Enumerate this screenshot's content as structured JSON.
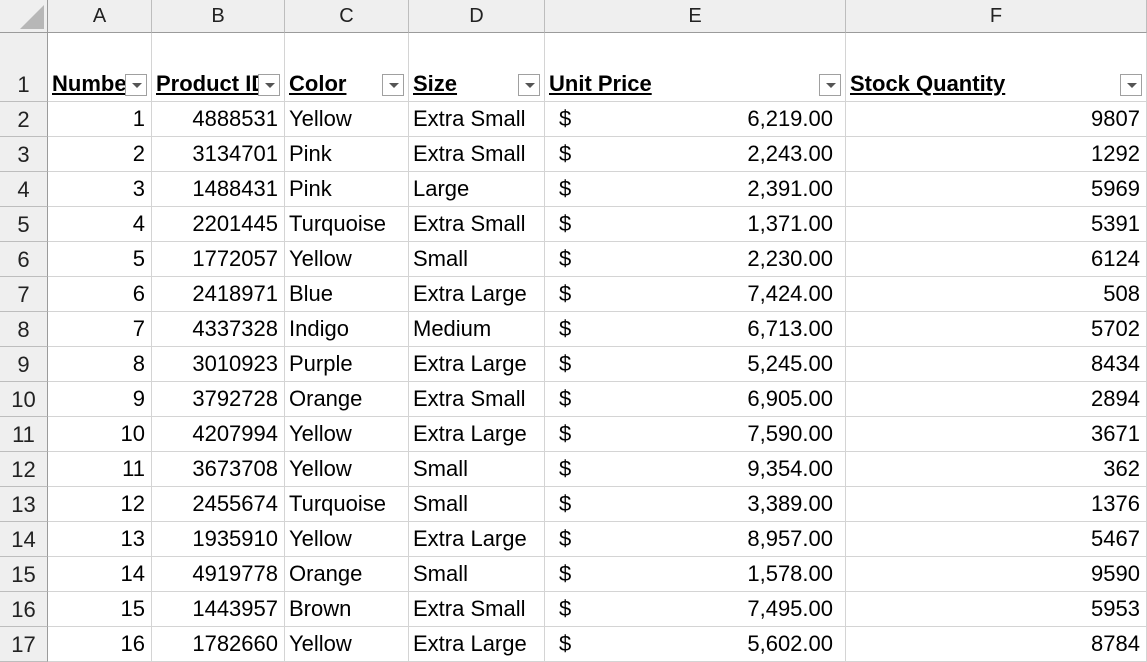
{
  "columns": [
    "A",
    "B",
    "C",
    "D",
    "E",
    "F"
  ],
  "headers": {
    "a": "Numbe",
    "b": "Product ID",
    "c": "Color",
    "d": "Size",
    "e": "Unit Price",
    "f": "Stock Quantity"
  },
  "currency_symbol": "$",
  "rows": [
    {
      "row": "2",
      "number": "1",
      "product_id": "4888531",
      "color": "Yellow",
      "size": "Extra Small",
      "unit_price": "6,219.00",
      "stock": "9807"
    },
    {
      "row": "3",
      "number": "2",
      "product_id": "3134701",
      "color": "Pink",
      "size": "Extra Small",
      "unit_price": "2,243.00",
      "stock": "1292"
    },
    {
      "row": "4",
      "number": "3",
      "product_id": "1488431",
      "color": "Pink",
      "size": "Large",
      "unit_price": "2,391.00",
      "stock": "5969"
    },
    {
      "row": "5",
      "number": "4",
      "product_id": "2201445",
      "color": "Turquoise",
      "size": "Extra Small",
      "unit_price": "1,371.00",
      "stock": "5391"
    },
    {
      "row": "6",
      "number": "5",
      "product_id": "1772057",
      "color": "Yellow",
      "size": "Small",
      "unit_price": "2,230.00",
      "stock": "6124"
    },
    {
      "row": "7",
      "number": "6",
      "product_id": "2418971",
      "color": "Blue",
      "size": "Extra Large",
      "unit_price": "7,424.00",
      "stock": "508"
    },
    {
      "row": "8",
      "number": "7",
      "product_id": "4337328",
      "color": "Indigo",
      "size": "Medium",
      "unit_price": "6,713.00",
      "stock": "5702"
    },
    {
      "row": "9",
      "number": "8",
      "product_id": "3010923",
      "color": "Purple",
      "size": "Extra Large",
      "unit_price": "5,245.00",
      "stock": "8434"
    },
    {
      "row": "10",
      "number": "9",
      "product_id": "3792728",
      "color": "Orange",
      "size": "Extra Small",
      "unit_price": "6,905.00",
      "stock": "2894"
    },
    {
      "row": "11",
      "number": "10",
      "product_id": "4207994",
      "color": "Yellow",
      "size": "Extra Large",
      "unit_price": "7,590.00",
      "stock": "3671"
    },
    {
      "row": "12",
      "number": "11",
      "product_id": "3673708",
      "color": "Yellow",
      "size": "Small",
      "unit_price": "9,354.00",
      "stock": "362"
    },
    {
      "row": "13",
      "number": "12",
      "product_id": "2455674",
      "color": "Turquoise",
      "size": "Small",
      "unit_price": "3,389.00",
      "stock": "1376"
    },
    {
      "row": "14",
      "number": "13",
      "product_id": "1935910",
      "color": "Yellow",
      "size": "Extra Large",
      "unit_price": "8,957.00",
      "stock": "5467"
    },
    {
      "row": "15",
      "number": "14",
      "product_id": "4919778",
      "color": "Orange",
      "size": "Small",
      "unit_price": "1,578.00",
      "stock": "9590"
    },
    {
      "row": "16",
      "number": "15",
      "product_id": "1443957",
      "color": "Brown",
      "size": "Extra Small",
      "unit_price": "7,495.00",
      "stock": "5953"
    },
    {
      "row": "17",
      "number": "16",
      "product_id": "1782660",
      "color": "Yellow",
      "size": "Extra Large",
      "unit_price": "5,602.00",
      "stock": "8784"
    }
  ],
  "header_row_label": "1",
  "colors": {
    "grid": "#d4d4d4",
    "header_bg": "#efefef"
  }
}
